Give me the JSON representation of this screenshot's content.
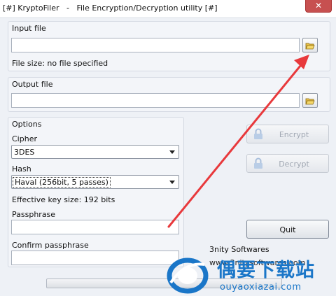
{
  "window": {
    "title": "[#] KryptoFiler   -   File Encryption/Decryption utility [#]",
    "close_label": "✕"
  },
  "input_group": {
    "label": "Input file",
    "value": "",
    "file_size": "File size: no file specified"
  },
  "output_group": {
    "label": "Output file",
    "value": ""
  },
  "options": {
    "label": "Options",
    "cipher_label": "Cipher",
    "cipher_value": "3DES",
    "hash_label": "Hash",
    "hash_value": "Haval (256bit, 5 passes)",
    "key_size": "Effective key size: 192 bits",
    "passphrase_label": "Passphrase",
    "passphrase_value": "",
    "confirm_label": "Confirm passphrase",
    "confirm_value": ""
  },
  "buttons": {
    "encrypt": "Encrypt",
    "decrypt": "Decrypt",
    "quit": "Quit"
  },
  "footer": {
    "company": "3nity Softwares",
    "website_partial": "www.3nitysoftwares.com",
    "progress": 0
  },
  "watermark": {
    "title": "偶要下载站",
    "url": "ouyaoxiazai.com"
  },
  "colors": {
    "annotation_arrow": "#e8393c",
    "watermark_blue": "#1a76c8"
  },
  "icons": {
    "browse": "folder-open-icon",
    "lock": "lock-icon"
  }
}
